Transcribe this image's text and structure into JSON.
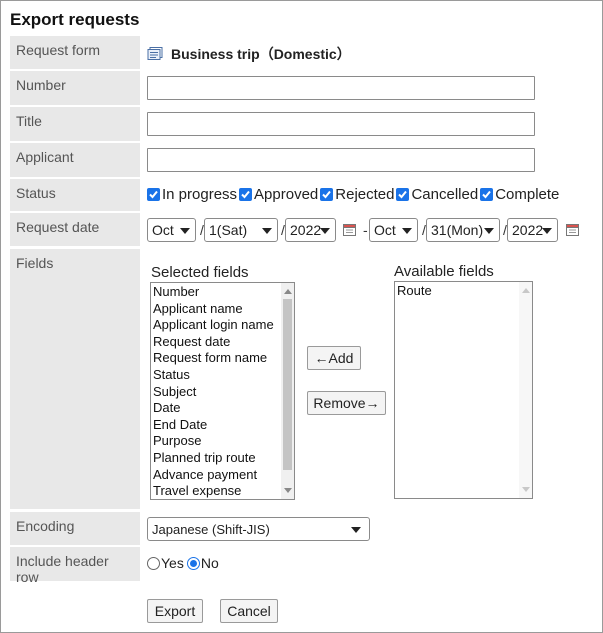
{
  "page_title": "Export requests",
  "labels": {
    "request_form": "Request form",
    "number": "Number",
    "title": "Title",
    "applicant": "Applicant",
    "status": "Status",
    "request_date": "Request date",
    "fields": "Fields",
    "encoding": "Encoding",
    "include_header_row": "Include header row"
  },
  "request_form_name": "Business trip（Domestic）",
  "inputs": {
    "number": "",
    "title": "",
    "applicant": ""
  },
  "status_options": [
    {
      "label": "In progress",
      "checked": true
    },
    {
      "label": "Approved",
      "checked": true
    },
    {
      "label": "Rejected",
      "checked": true
    },
    {
      "label": "Cancelled",
      "checked": true
    },
    {
      "label": "Complete",
      "checked": true
    }
  ],
  "date_from": {
    "month": "Oct",
    "day": "1(Sat)",
    "year": "2022"
  },
  "date_to": {
    "month": "Oct",
    "day": "31(Mon)",
    "year": "2022"
  },
  "date_separator": "/",
  "range_separator": "-",
  "selected_fields_title": "Selected fields",
  "available_fields_title": "Available fields",
  "selected_fields": [
    "Number",
    "Applicant name",
    "Applicant login name",
    "Request date",
    "Request form name",
    "Status",
    "Subject",
    "Date",
    "End Date",
    "Purpose",
    "Planned trip route",
    "Advance payment",
    "Travel expense"
  ],
  "available_fields": [
    "Route"
  ],
  "add_button": "←Add",
  "remove_button": "Remove→",
  "encoding_value": "Japanese (Shift-JIS)",
  "header_row": {
    "yes_label": "Yes",
    "no_label": "No",
    "selected": "No"
  },
  "export_button": "Export",
  "cancel_button": "Cancel",
  "colors": {
    "accent": "#1a73e8",
    "label_bg": "#e8e8e8",
    "calendar_red": "#d9534f"
  }
}
